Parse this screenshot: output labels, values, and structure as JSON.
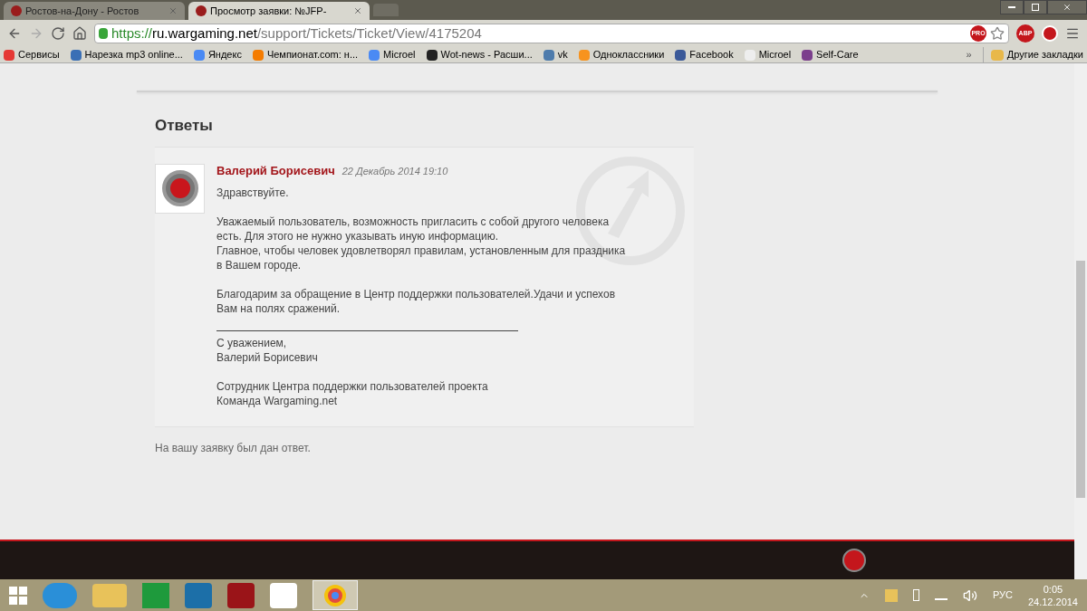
{
  "browser": {
    "tabs": [
      {
        "title": "Ростов-на-Дону - Ростов",
        "selected": false
      },
      {
        "title": "Просмотр заявки: №JFP-",
        "selected": true
      }
    ],
    "url": {
      "scheme": "https://",
      "host": "ru.wargaming.net",
      "path": "/support/Tickets/Ticket/View/4175204"
    },
    "bookmarks": [
      {
        "label": "Сервисы"
      },
      {
        "label": "Нарезка mp3 online..."
      },
      {
        "label": "Яндекс"
      },
      {
        "label": "Чемпионат.com: н..."
      },
      {
        "label": "Microel"
      },
      {
        "label": "Wot-news - Расши..."
      },
      {
        "label": "vk"
      },
      {
        "label": "Одноклассники"
      },
      {
        "label": "Facebook"
      },
      {
        "label": "Microel"
      },
      {
        "label": "Self-Care"
      }
    ],
    "overflow": "»",
    "other_bookmarks": "Другие закладки",
    "pro_badge": "PRO",
    "abp_badge": "ABP"
  },
  "page": {
    "heading": "Ответы",
    "reply": {
      "author": "Валерий Борисевич",
      "date": "22 Декабрь 2014 19:10",
      "paragraphs": [
        [
          "Здравствуйте."
        ],
        [
          "Уважаемый пользователь, возможность пригласить с собой другого человека",
          "есть. Для этого не нужно указывать иную информацию.",
          "Главное, чтобы человек удовлетворял правилам, установленным для праздника",
          "в Вашем городе."
        ],
        [
          "Благодарим за обращение в Центр поддержки пользователей.Удачи и успехов",
          "Вам на полях сражений."
        ]
      ],
      "signature": [
        [
          "С уважением,",
          "Валерий Борисевич"
        ],
        [
          "Сотрудник Центра поддержки пользователей проекта",
          "Команда Wargaming.net"
        ]
      ]
    },
    "status_note": "На вашу заявку был дан ответ."
  },
  "taskbar": {
    "language": "РУС",
    "time": "0:05",
    "date": "24.12.2014"
  }
}
